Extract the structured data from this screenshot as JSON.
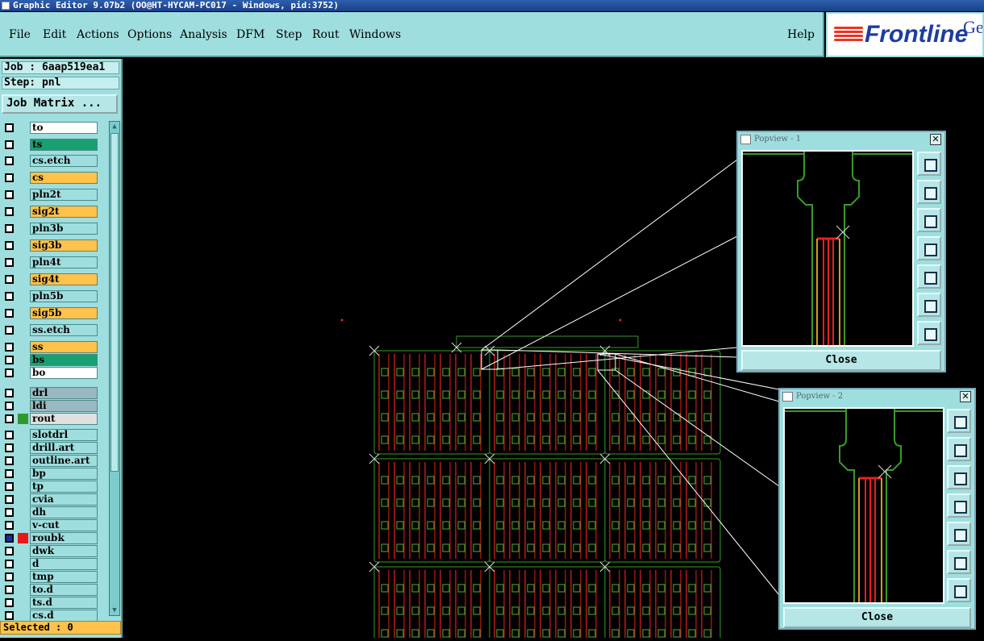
{
  "window": {
    "title": "Graphic Editor 9.07b2 (OO@HT-HYCAM-PC017 - Windows, pid:3752)"
  },
  "menu": [
    "File",
    "Edit",
    "Actions",
    "Options",
    "Analysis",
    "DFM",
    "Step",
    "Rout",
    "Windows"
  ],
  "help_label": "Help",
  "logo": {
    "brand": "Frontline",
    "brand_suffix": "Ge"
  },
  "job": {
    "label": "Job : 6aap519ea1",
    "step": "Step: pnl"
  },
  "job_matrix_button": "Job Matrix ...",
  "layers": [
    {
      "name": "to",
      "bg": "#ffffff",
      "swatch": ""
    },
    {
      "name": "ts",
      "bg": "#18a070",
      "swatch": ""
    },
    {
      "name": "cs.etch",
      "bg": "#9fdede",
      "swatch": ""
    },
    {
      "name": "cs",
      "bg": "#ffc24a",
      "swatch": ""
    },
    {
      "name": "pln2t",
      "bg": "#9fdede",
      "swatch": ""
    },
    {
      "name": "sig2t",
      "bg": "#ffc24a",
      "swatch": ""
    },
    {
      "name": "pln3b",
      "bg": "#9fdede",
      "swatch": ""
    },
    {
      "name": "sig3b",
      "bg": "#ffc24a",
      "swatch": ""
    },
    {
      "name": "pln4t",
      "bg": "#9fdede",
      "swatch": ""
    },
    {
      "name": "sig4t",
      "bg": "#ffc24a",
      "swatch": ""
    },
    {
      "name": "pln5b",
      "bg": "#9fdede",
      "swatch": ""
    },
    {
      "name": "sig5b",
      "bg": "#ffc24a",
      "swatch": ""
    },
    {
      "name": "ss.etch",
      "bg": "#9fdede",
      "swatch": ""
    },
    {
      "name": "ss",
      "bg": "#ffc24a",
      "swatch": ""
    },
    {
      "name": "bs",
      "bg": "#18a070",
      "swatch": ""
    },
    {
      "name": "bo",
      "bg": "#ffffff",
      "swatch": ""
    },
    {
      "name": "drl",
      "bg": "#9ab8c0",
      "swatch": ""
    },
    {
      "name": "ldi",
      "bg": "#9ab8c0",
      "swatch": ""
    },
    {
      "name": "rout",
      "bg": "#e0e0e0",
      "swatch": "#2e9a2e"
    },
    {
      "name": "slotdrl",
      "bg": "#9fdede",
      "swatch": ""
    },
    {
      "name": "drill.art",
      "bg": "#9fdede",
      "swatch": ""
    },
    {
      "name": "outline.art",
      "bg": "#9fdede",
      "swatch": ""
    },
    {
      "name": "bp",
      "bg": "#9fdede",
      "swatch": ""
    },
    {
      "name": "tp",
      "bg": "#9fdede",
      "swatch": ""
    },
    {
      "name": "cvia",
      "bg": "#9fdede",
      "swatch": ""
    },
    {
      "name": "dh",
      "bg": "#9fdede",
      "swatch": ""
    },
    {
      "name": "v-cut",
      "bg": "#9fdede",
      "swatch": ""
    },
    {
      "name": "roubk",
      "bg": "#9fdede",
      "swatch": "#e81818",
      "active": true
    },
    {
      "name": "dwk",
      "bg": "#9fdede",
      "swatch": ""
    },
    {
      "name": "d",
      "bg": "#9fdede",
      "swatch": ""
    },
    {
      "name": "tmp",
      "bg": "#9fdede",
      "swatch": ""
    },
    {
      "name": "to.d",
      "bg": "#9fdede",
      "swatch": ""
    },
    {
      "name": "ts.d",
      "bg": "#9fdede",
      "swatch": ""
    },
    {
      "name": "cs.d",
      "bg": "#9fdede",
      "swatch": ""
    }
  ],
  "selected": "Selected : 0",
  "popviews": [
    {
      "title": "Popview - 1",
      "close_label": "Close"
    },
    {
      "title": "Popview - 2",
      "close_label": "Close"
    }
  ],
  "colors": {
    "panel": "#9fdede",
    "rout_green": "#3a9a2a",
    "trace_red": "#e82020",
    "trace_orange": "#d89a20"
  }
}
